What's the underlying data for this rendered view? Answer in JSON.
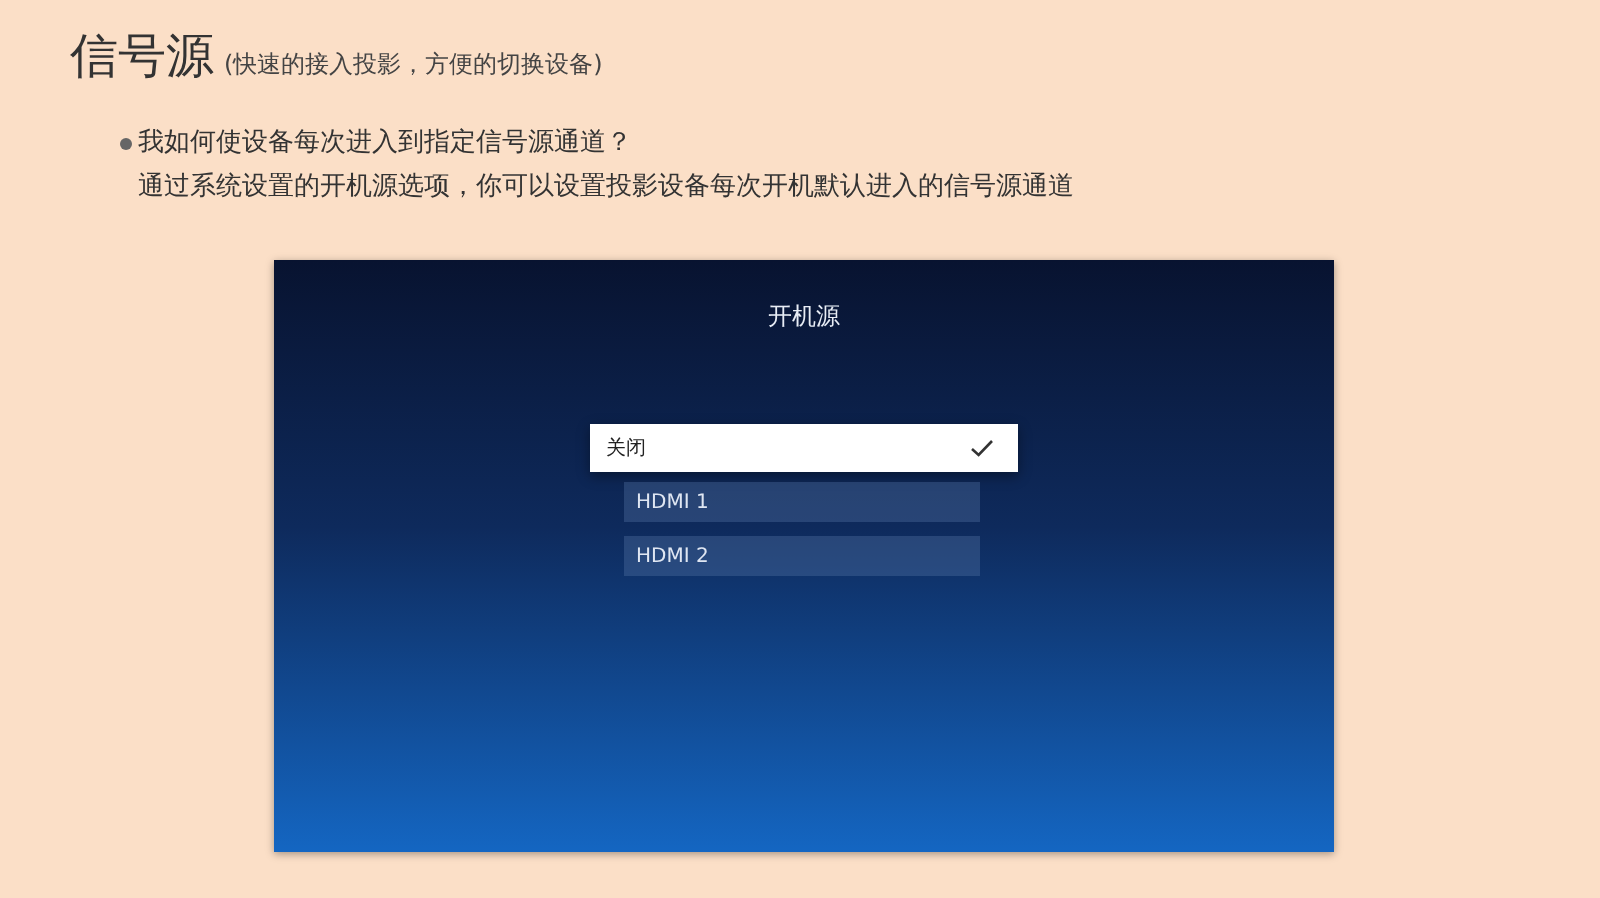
{
  "page": {
    "title": "信号源",
    "subtitle": "(快速的接入投影，方便的切换设备)"
  },
  "faq": {
    "question": "我如何使设备每次进入到指定信号源通道？",
    "answer": "通过系统设置的开机源选项，你可以设置投影设备每次开机默认进入的信号源通道"
  },
  "screen": {
    "title": "开机源",
    "options": [
      {
        "label": "关闭",
        "selected": true
      },
      {
        "label": "HDMI 1",
        "selected": false
      },
      {
        "label": "HDMI 2",
        "selected": false
      }
    ]
  }
}
